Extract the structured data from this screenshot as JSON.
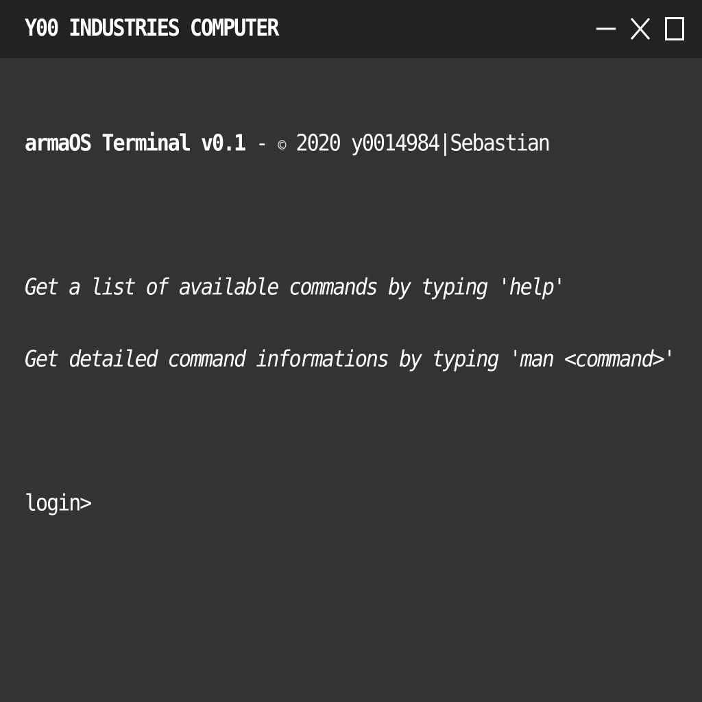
{
  "window": {
    "title": "Y00 INDUSTRIES COMPUTER",
    "background_color": "#333333",
    "titlebar_color": "#222222",
    "text_color": "#ffffff",
    "controls": [
      {
        "name": "minimize-icon"
      },
      {
        "name": "close-icon"
      },
      {
        "name": "maximize-icon"
      }
    ]
  },
  "terminal": {
    "header": {
      "product": "armaOS Terminal v0.1",
      "separator": " - ",
      "copyright_symbol": "©",
      "rest": " 2020 y0014984|Sebastian"
    },
    "hints": [
      "Get a list of available commands by typing 'help'",
      "Get detailed command informations by typing 'man <command>'"
    ],
    "prompt": "login>",
    "input_value": ""
  }
}
